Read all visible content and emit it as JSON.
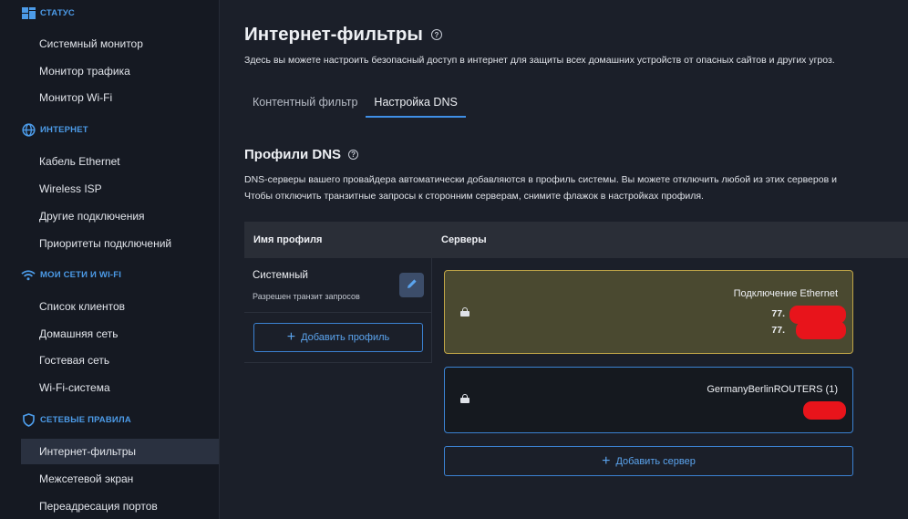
{
  "sidebar": {
    "sections": [
      {
        "title": "СТАТУС",
        "icon": "dashboard-icon",
        "items": [
          "Системный монитор",
          "Монитор трафика",
          "Монитор Wi-Fi"
        ]
      },
      {
        "title": "ИНТЕРНЕТ",
        "icon": "globe-icon",
        "items": [
          "Кабель Ethernet",
          "Wireless ISP",
          "Другие подключения",
          "Приоритеты подключений"
        ]
      },
      {
        "title": "МОИ СЕТИ И WI-FI",
        "icon": "wifi-icon",
        "items": [
          "Список клиентов",
          "Домашняя сеть",
          "Гостевая сеть",
          "Wi-Fi-система"
        ]
      },
      {
        "title": "СЕТЕВЫЕ ПРАВИЛА",
        "icon": "shield-icon",
        "items": [
          "Интернет-фильтры",
          "Межсетевой экран",
          "Переадресация портов"
        ]
      }
    ],
    "active_item": "Интернет-фильтры",
    "accent_color": "#4c9be8"
  },
  "page": {
    "title": "Интернет-фильтры",
    "description": "Здесь вы можете настроить безопасный доступ в интернет для защиты всех домашних устройств от опасных сайтов и других угроз.",
    "tabs": [
      "Контентный фильтр",
      "Настройка DNS"
    ],
    "active_tab": "Настройка DNS"
  },
  "dns_profiles": {
    "title": "Профили DNS",
    "desc_line1": "DNS-серверы вашего провайдера автоматически добавляются в профиль системы. Вы можете отключить любой из этих серверов и",
    "desc_line2": "Чтобы отключить транзитные запросы к сторонним серверам, снимите флажок в настройках профиля.",
    "col_name": "Имя профиля",
    "col_servers": "Серверы",
    "profile": {
      "name": "Системный",
      "subtitle": "Разрешен транзит запросов"
    },
    "add_profile_label": "Добавить профиль",
    "servers": [
      {
        "title": "Подключение Ethernet",
        "ips": [
          "77.",
          "77."
        ],
        "locked": true,
        "highlight_color": "#bfa447"
      },
      {
        "title": "GermanyBerlinROUTERS (1)",
        "ips": [],
        "locked": true
      }
    ],
    "add_server_label": "Добавить сервер"
  }
}
